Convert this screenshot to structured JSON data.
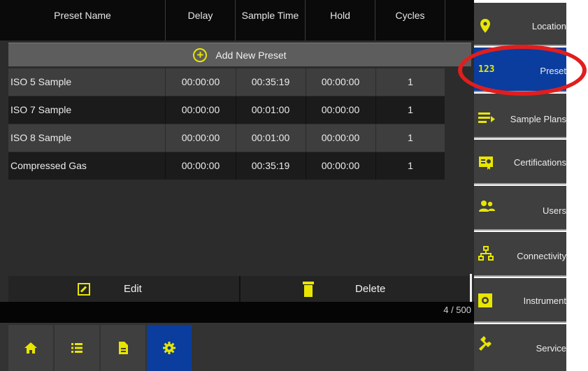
{
  "table": {
    "columns": [
      "Preset Name",
      "Delay",
      "Sample Time",
      "Hold",
      "Cycles"
    ],
    "add_label": "Add New Preset",
    "rows": [
      {
        "name": "ISO 5 Sample",
        "delay": "00:00:00",
        "sample_time": "00:35:19",
        "hold": "00:00:00",
        "cycles": "1"
      },
      {
        "name": "ISO 7 Sample",
        "delay": "00:00:00",
        "sample_time": "00:01:00",
        "hold": "00:00:00",
        "cycles": "1"
      },
      {
        "name": "ISO 8 Sample",
        "delay": "00:00:00",
        "sample_time": "00:01:00",
        "hold": "00:00:00",
        "cycles": "1"
      },
      {
        "name": "Compressed Gas",
        "delay": "00:00:00",
        "sample_time": "00:35:19",
        "hold": "00:00:00",
        "cycles": "1"
      }
    ]
  },
  "actions": {
    "edit_label": "Edit",
    "delete_label": "Delete"
  },
  "count": "4 / 500",
  "side_nav": {
    "items": [
      {
        "label": "Location",
        "icon": "location-pin-icon"
      },
      {
        "label": "Preset",
        "icon": "123-numbers-icon",
        "badge": "123",
        "active": true
      },
      {
        "label": "Sample Plans",
        "icon": "list-icon"
      },
      {
        "label": "Certifications",
        "icon": "certificate-icon"
      },
      {
        "label": "Users",
        "icon": "users-icon"
      },
      {
        "label": "Connectivity",
        "icon": "network-icon"
      },
      {
        "label": "Instrument",
        "icon": "instrument-gear-icon"
      },
      {
        "label": "Service",
        "icon": "wrench-icon"
      }
    ]
  },
  "bottom_nav": {
    "items": [
      {
        "icon": "home-icon"
      },
      {
        "icon": "list-icon"
      },
      {
        "icon": "document-icon"
      },
      {
        "icon": "gear-icon",
        "active": true
      }
    ]
  },
  "colors": {
    "accent_yellow": "#e8e600",
    "active_blue": "#0a3d9e",
    "highlight_red": "#e01e1e"
  }
}
